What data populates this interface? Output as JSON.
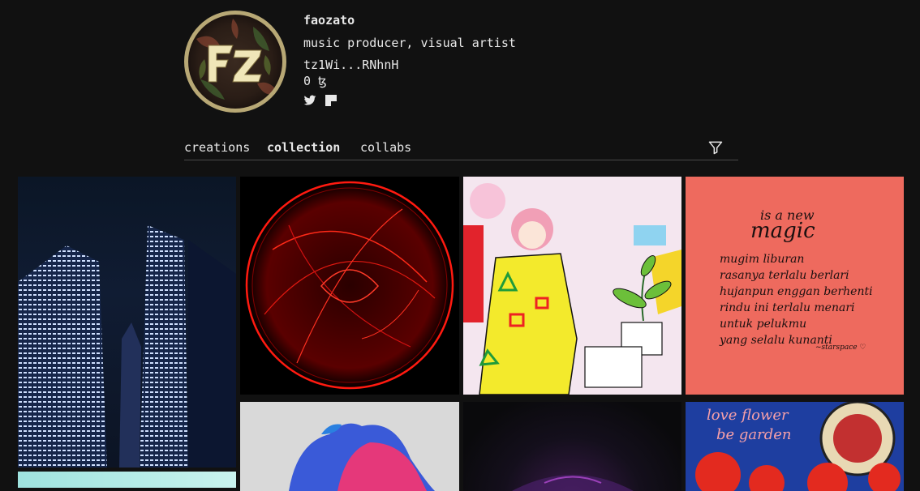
{
  "profile": {
    "name": "faozato",
    "bio": "music producer, visual artist",
    "address": "tz1Wi...RNhnH",
    "balance": "0 ꜩ",
    "socials": [
      "twitter-icon",
      "flag-icon"
    ],
    "avatar_text": "FZ"
  },
  "tabs": [
    {
      "label": "creations",
      "active": false
    },
    {
      "label": "collection",
      "active": true
    },
    {
      "label": "collabs",
      "active": false
    }
  ],
  "filter_icon": "filter-icon",
  "gallery": {
    "tiles": [
      {
        "subject": "night skyscrapers"
      },
      {
        "subject": "red glowing sphere"
      },
      {
        "subject": "pink-haired girl with plant"
      },
      {
        "subject": "handwritten poem on coral background"
      },
      {
        "subject": "teal abstract"
      },
      {
        "subject": "blue and pink smoke"
      },
      {
        "subject": "dark purple glow"
      },
      {
        "subject": "love flower be garden"
      }
    ],
    "poem": {
      "lines": [
        "is a new",
        "magic",
        "mugim liburan",
        "rasanya terlalu berlari",
        "hujanpun enggan berhenti",
        "rindu ini terlalu menari",
        "untuk pelukmu",
        "yang selalu kunanti",
        "~starspace ♡"
      ]
    },
    "garden_text": [
      "love flower",
      "be garden"
    ]
  }
}
